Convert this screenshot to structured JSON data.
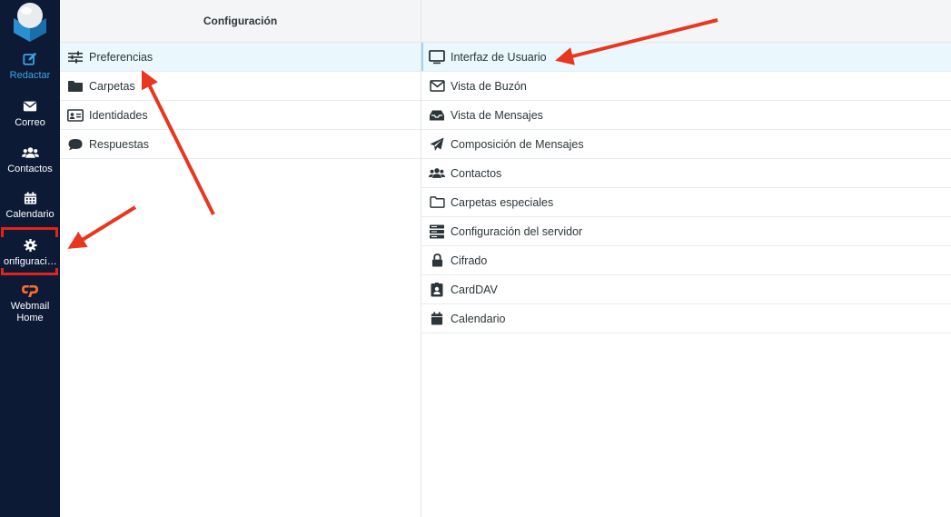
{
  "sidebar": {
    "items": [
      {
        "label": "Redactar",
        "icon": "compose-icon"
      },
      {
        "label": "Correo",
        "icon": "envelope-icon"
      },
      {
        "label": "Contactos",
        "icon": "users-icon"
      },
      {
        "label": "Calendario",
        "icon": "calendar-icon"
      },
      {
        "label": "onfiguraci…",
        "icon": "gear-icon"
      },
      {
        "label": "Webmail Home",
        "icon": "cpanel-icon"
      }
    ]
  },
  "settings_column": {
    "title": "Configuración",
    "items": [
      {
        "label": "Preferencias",
        "icon": "sliders-icon"
      },
      {
        "label": "Carpetas",
        "icon": "folder-icon"
      },
      {
        "label": "Identidades",
        "icon": "id-card-icon"
      },
      {
        "label": "Respuestas",
        "icon": "comment-icon"
      }
    ]
  },
  "preferences_column": {
    "items": [
      {
        "label": "Interfaz de Usuario",
        "icon": "monitor-icon"
      },
      {
        "label": "Vista de Buzón",
        "icon": "envelope-outline-icon"
      },
      {
        "label": "Vista de Mensajes",
        "icon": "inbox-icon"
      },
      {
        "label": "Composición de Mensajes",
        "icon": "paper-plane-icon"
      },
      {
        "label": "Contactos",
        "icon": "users-icon"
      },
      {
        "label": "Carpetas especiales",
        "icon": "folder-outline-icon"
      },
      {
        "label": "Configuración del servidor",
        "icon": "server-icon"
      },
      {
        "label": "Cifrado",
        "icon": "lock-icon"
      },
      {
        "label": "CardDAV",
        "icon": "address-book-icon"
      },
      {
        "label": "Calendario",
        "icon": "calendar-icon"
      }
    ]
  },
  "colors": {
    "accent": "#e3231a",
    "sidebar": "#0c1a36",
    "compose": "#38a7e8",
    "cpanel": "#ff6c2c"
  }
}
